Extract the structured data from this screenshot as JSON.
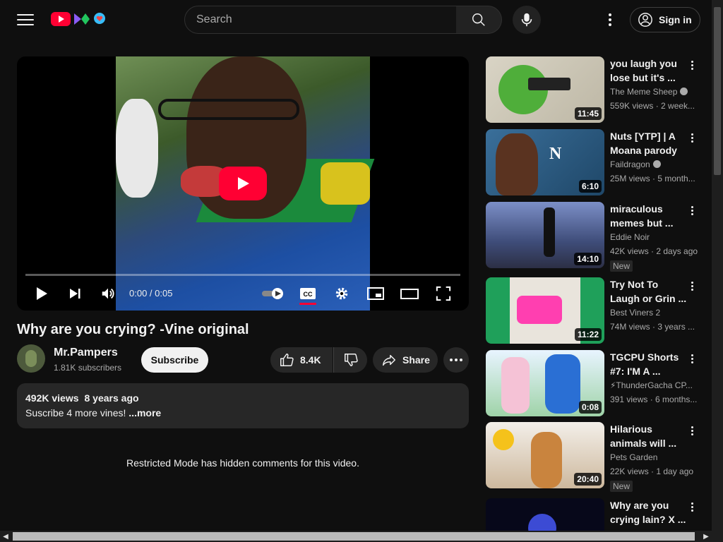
{
  "header": {
    "search_placeholder": "Search",
    "sign_in": "Sign in"
  },
  "player": {
    "time": "0:00 / 0:05",
    "progress": 0,
    "accent": "#ff0033"
  },
  "video": {
    "title": "Why are you crying? -Vine original",
    "channel": "Mr.Pampers",
    "subscribers": "1.81K subscribers",
    "subscribe": "Subscribe",
    "likes": "8.4K",
    "share": "Share",
    "views": "492K views",
    "age": "8 years ago",
    "description": "Suscribe 4 more vines!",
    "more": "...more",
    "restricted": "Restricted Mode has hidden comments for this video."
  },
  "recommended": [
    {
      "title": "you laugh you lose but it's ...",
      "channel": "The Meme Sheep",
      "verified": true,
      "stats": "559K views · 2 week...",
      "duration": "11:45",
      "badge": ""
    },
    {
      "title": "Nuts [YTP] | A Moana parody",
      "channel": "Faildragon",
      "verified": true,
      "stats": "25M views · 5 month...",
      "duration": "6:10",
      "badge": ""
    },
    {
      "title": "miraculous memes but ...",
      "channel": "Eddie Noir",
      "verified": false,
      "stats": "42K views · 2 days ago",
      "duration": "14:10",
      "badge": "New"
    },
    {
      "title": "Try Not To Laugh or Grin ...",
      "channel": "Best Viners 2",
      "verified": false,
      "stats": "74M views · 3 years ...",
      "duration": "11:22",
      "badge": ""
    },
    {
      "title": "TGCPU Shorts #7: I'M A ...",
      "channel": "⚡ThunderGacha CP...",
      "verified": false,
      "stats": "391 views · 6 months...",
      "duration": "0:08",
      "badge": ""
    },
    {
      "title": "Hilarious animals will ...",
      "channel": "Pets Garden",
      "verified": false,
      "stats": "22K views · 1 day ago",
      "duration": "20:40",
      "badge": "New"
    },
    {
      "title": "Why are you crying lain? X ...",
      "channel": "",
      "verified": false,
      "stats": "",
      "duration": "",
      "badge": ""
    }
  ]
}
